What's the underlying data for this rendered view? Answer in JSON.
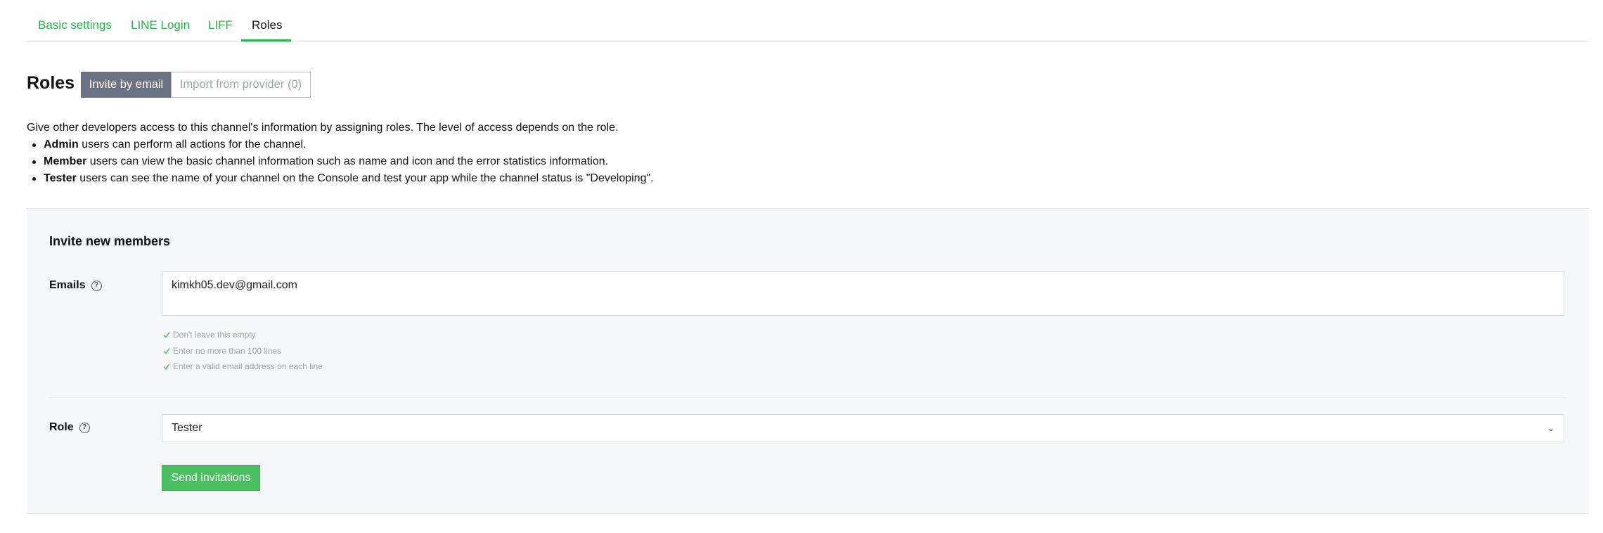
{
  "tabs": [
    {
      "label": "Basic settings"
    },
    {
      "label": "LINE Login"
    },
    {
      "label": "LIFF"
    },
    {
      "label": "Roles"
    }
  ],
  "roles": {
    "title": "Roles",
    "seg_active": "Invite by email",
    "seg_inactive": "Import from provider (0)"
  },
  "description": {
    "intro": "Give other developers access to this channel's information by assigning roles. The level of access depends on the role.",
    "items": [
      {
        "role": "Admin",
        "text": " users can perform all actions for the channel."
      },
      {
        "role": "Member",
        "text": " users can view the basic channel information such as name and icon and the error statistics information."
      },
      {
        "role": "Tester",
        "text": " users can see the name of your channel on the Console and test your app while the channel status is \"Developing\"."
      }
    ]
  },
  "invite": {
    "title": "Invite new members",
    "emails_label": "Emails",
    "emails_value": "kimkh05.dev@gmail.com",
    "hints": [
      "Don't leave this empty",
      "Enter no more than 100 lines",
      "Enter a valid email address on each line"
    ],
    "role_label": "Role",
    "role_value": "Tester",
    "send_label": "Send invitations"
  },
  "colors": {
    "accent": "#2bb14a",
    "button": "#4cbf62",
    "segment_active": "#6b7282"
  },
  "icons": {
    "help": "question-circle-icon",
    "check": "check-icon",
    "select": "chevron-down-icon"
  }
}
